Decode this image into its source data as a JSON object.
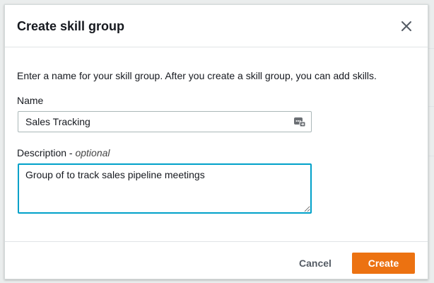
{
  "modal": {
    "title": "Create skill group",
    "intro": "Enter a name for your skill group. After you create a skill group, you can add skills.",
    "name_label": "Name",
    "name_value": "Sales Tracking",
    "description_label": "Description - ",
    "description_optional": "optional",
    "description_value": "Group of to track sales pipeline meetings",
    "cancel_label": "Cancel",
    "create_label": "Create"
  },
  "colors": {
    "primary": "#ec7211",
    "focus": "#00a1c9",
    "text": "#16191f"
  },
  "icons": {
    "close": "close-icon",
    "input_autofill": "autofill-icon"
  }
}
